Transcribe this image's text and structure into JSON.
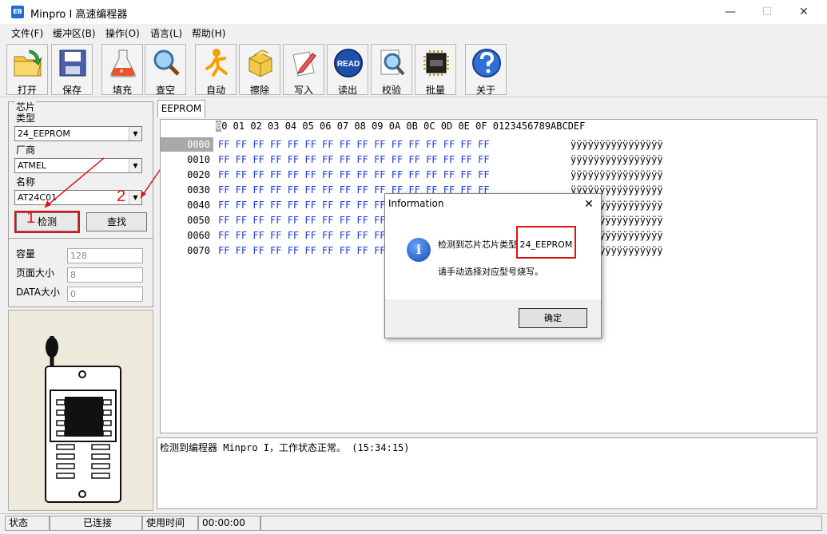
{
  "window": {
    "title": "Minpro I 高速编程器",
    "app_icon_text": "EB",
    "min_symbol": "—",
    "max_symbol": "☐",
    "close_symbol": "✕"
  },
  "menu": [
    "文件(F)",
    "缓冲区(B)",
    "操作(O)",
    "语言(L)",
    "帮助(H)"
  ],
  "toolbar": [
    {
      "label": "打开",
      "icon": "open-folder-icon"
    },
    {
      "label": "保存",
      "icon": "floppy-disk-icon"
    },
    {
      "label": "填充",
      "icon": "flask-icon"
    },
    {
      "label": "查空",
      "icon": "magnifier-icon"
    },
    {
      "label": "自动",
      "icon": "running-man-icon"
    },
    {
      "label": "擦除",
      "icon": "box-icon"
    },
    {
      "label": "写入",
      "icon": "pen-paper-icon"
    },
    {
      "label": "读出",
      "icon": "read-badge-icon",
      "badge": "READ"
    },
    {
      "label": "校验",
      "icon": "magnifier-doc-icon"
    },
    {
      "label": "批量",
      "icon": "chip-icon"
    },
    {
      "label": "关于",
      "icon": "help-icon"
    }
  ],
  "chip_panel": {
    "group_title": "芯片",
    "type_label": "类型",
    "type_value": "24_EEPROM",
    "vendor_label": "厂商",
    "vendor_value": "ATMEL",
    "name_label": "名称",
    "name_value": "AT24C01",
    "detect_button": "检测",
    "find_button": "查找",
    "capacity_label": "容量",
    "capacity_value": "128",
    "page_size_label": "页面大小",
    "page_size_value": "8",
    "data_size_label": "DATA大小",
    "data_size_value": "0"
  },
  "annotations": {
    "num1": "1",
    "num2": "2"
  },
  "hex_view": {
    "tab": "EEPROM",
    "header": "00 01 02 03 04 05 06 07 08 09 0A 0B 0C 0D 0E 0F   0123456789ABCDEF",
    "addresses": [
      "0000",
      "0010",
      "0020",
      "0030",
      "0040",
      "0050",
      "0060",
      "0070"
    ],
    "bytes_full": "FF FF FF FF FF FF FF FF FF FF FF FF FF FF FF FF",
    "bytes_left": "FF FF FF FF FF FF FF FF",
    "ascii": "ÿÿÿÿÿÿÿÿÿÿÿÿÿÿÿÿ"
  },
  "log": "检测到编程器 Minpro I，工作状态正常。 (15:34:15)",
  "statusbar": {
    "status_label": "状态",
    "status_value": "已连接",
    "time_label": "使用时间",
    "time_value": "00:00:00"
  },
  "dialog": {
    "title": "Information",
    "close": "✕",
    "message1_prefix": "检测到芯片芯片类型",
    "message1_value": "24_EEPROM",
    "message2": "请手动选择对应型号烧写。",
    "ok_button": "确定",
    "icon_glyph": "i"
  },
  "colors": {
    "hex_text": "#1e3cd6",
    "annotation_red": "#e01010"
  }
}
